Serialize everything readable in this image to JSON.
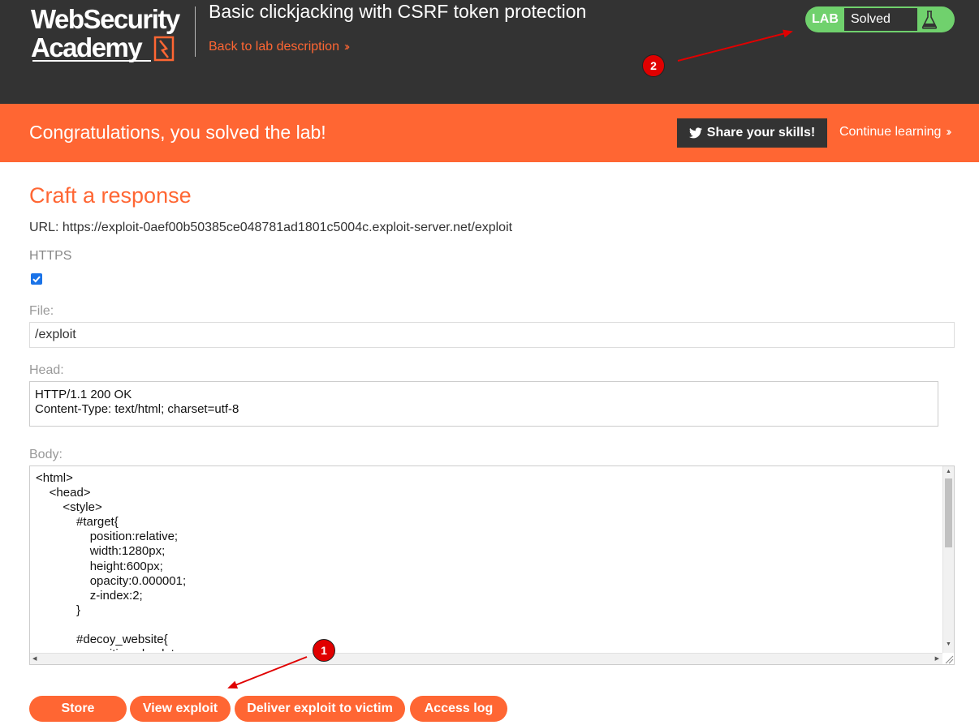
{
  "header": {
    "logo_line1": "WebSecurity",
    "logo_line2": "Academy",
    "lab_title": "Basic clickjacking with CSRF token protection",
    "back_link": "Back to lab description",
    "lab_badge_label": "LAB",
    "lab_status": "Solved"
  },
  "banner": {
    "message": "Congratulations, you solved the lab!",
    "share_button": "Share your skills!",
    "continue_link": "Continue learning"
  },
  "form": {
    "heading": "Craft a response",
    "url_line": "URL: https://exploit-0aef00b50385ce048781ad1801c5004c.exploit-server.net/exploit",
    "https_label": "HTTPS",
    "https_checked": true,
    "file_label": "File:",
    "file_value": "/exploit",
    "head_label": "Head:",
    "head_value": "HTTP/1.1 200 OK\nContent-Type: text/html; charset=utf-8",
    "body_label": "Body:",
    "body_value": "<html>\n\t<head>\n\t\t<style>\n\t\t\t#target{\n\t\t\t\tposition:relative;\n\t\t\t\twidth:1280px;\n\t\t\t\theight:600px;\n\t\t\t\topacity:0.000001;\n\t\t\t\tz-index:2;\n\t\t\t}\n\n\t\t\t#decoy_website{\n\t\t\t\tposition:absolute;"
  },
  "actions": {
    "store": "Store",
    "view_exploit": "View exploit",
    "deliver": "Deliver exploit to victim",
    "access_log": "Access log"
  },
  "annotations": {
    "marker_1": "1",
    "marker_2": "2"
  },
  "colors": {
    "brand_orange": "#ff6633",
    "header_dark": "#333333",
    "solved_green": "#70d16d",
    "annotation_red": "#e00000"
  }
}
